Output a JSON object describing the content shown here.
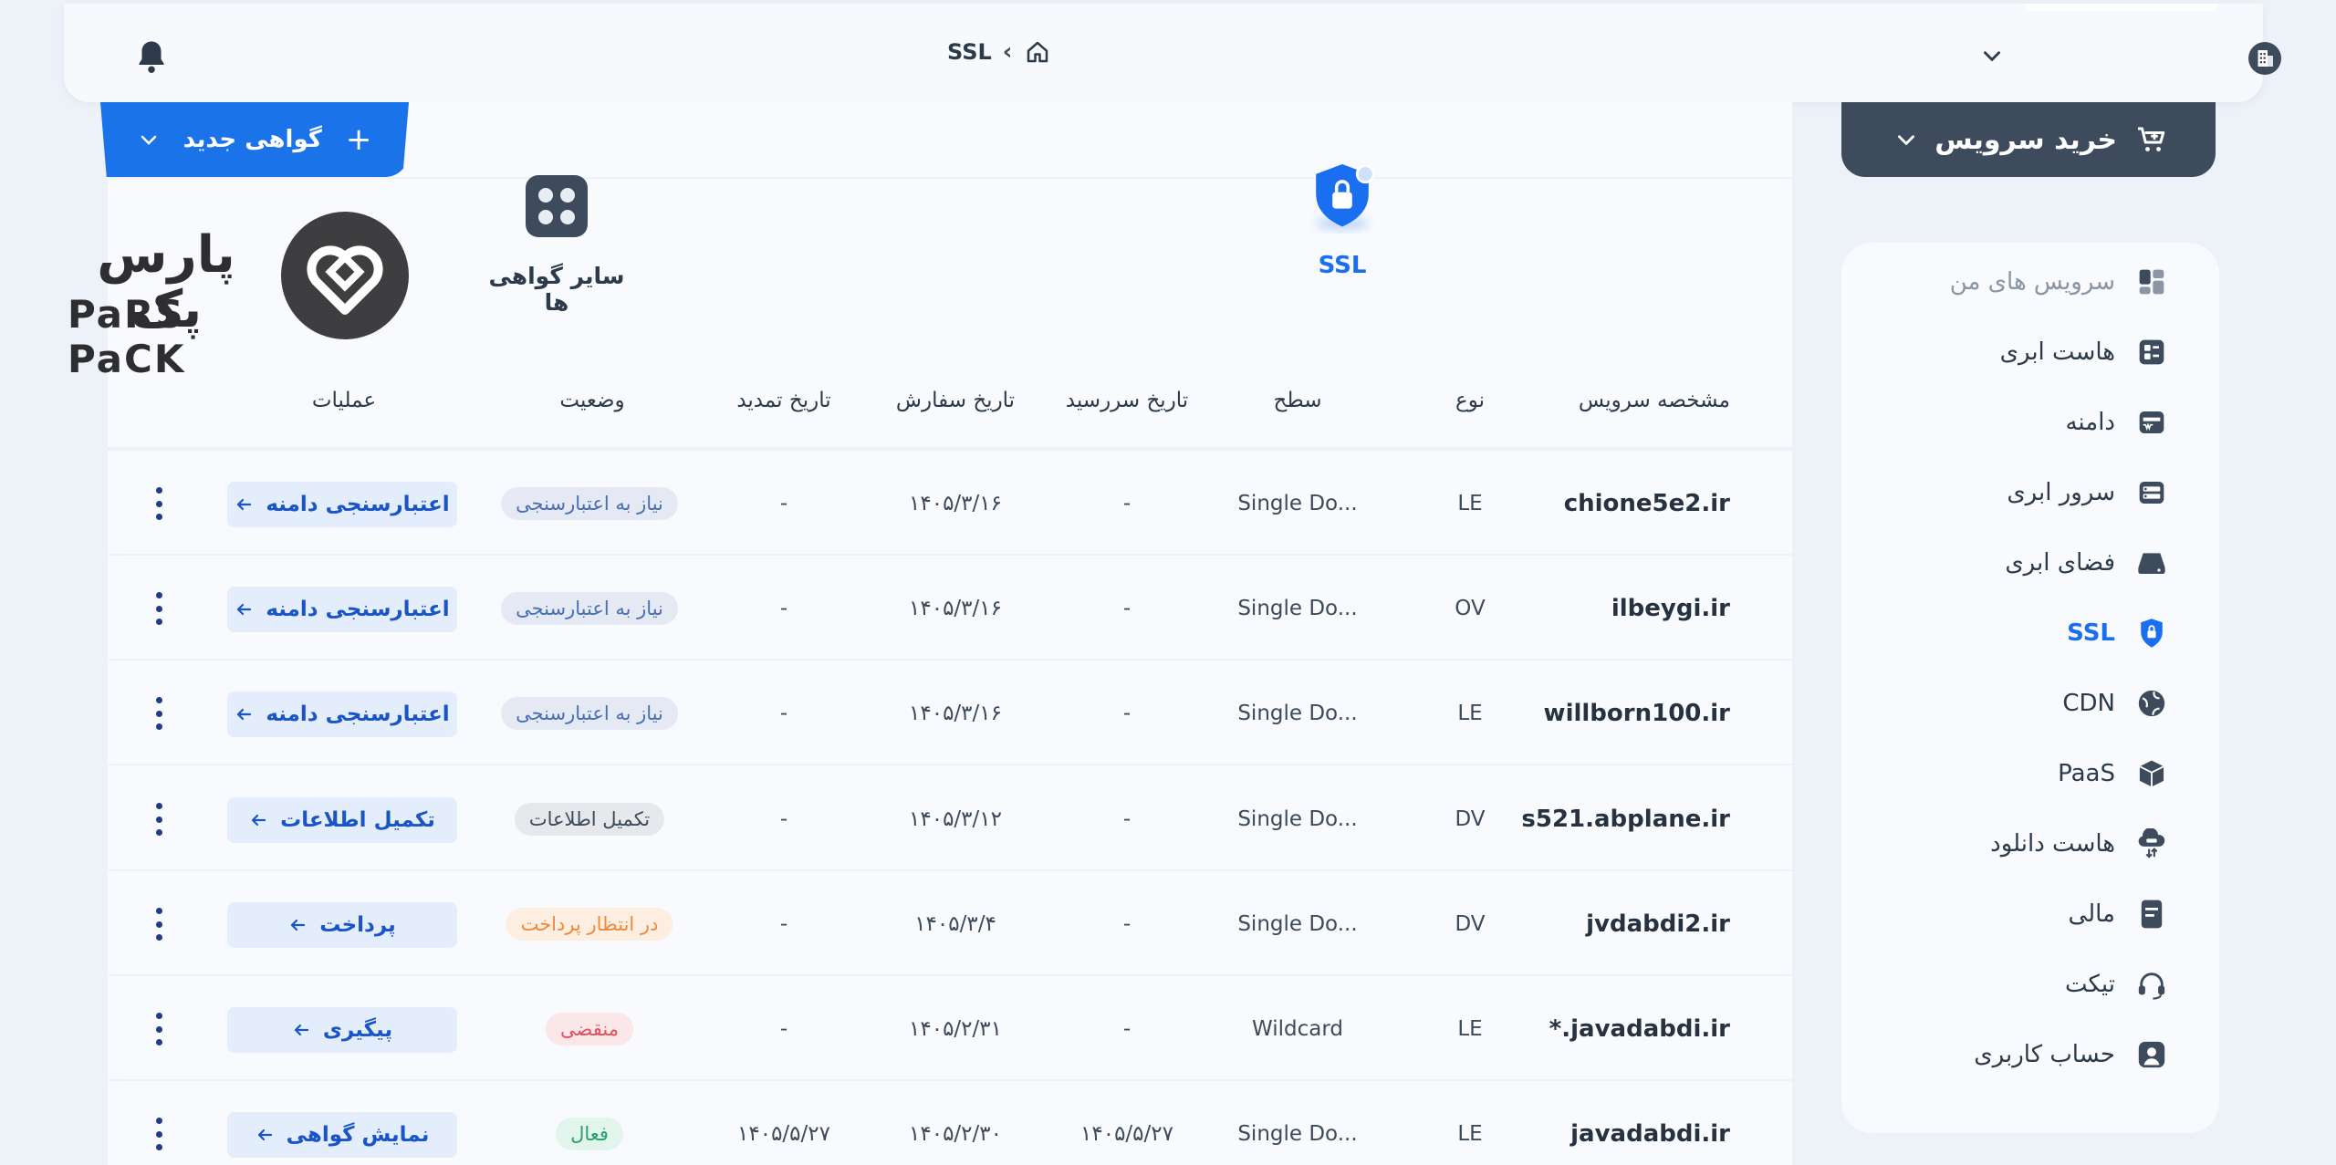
{
  "topbar": {
    "breadcrumb_current": "SSL",
    "breadcrumb_sep": "‹"
  },
  "sidebar": {
    "buy_label": "خرید سرویس",
    "items": [
      {
        "label": "سرویس های من",
        "icon": "dashboard-icon",
        "state": "muted"
      },
      {
        "label": "هاست ابری",
        "icon": "cloud-host-icon",
        "state": "normal"
      },
      {
        "label": "دامنه",
        "icon": "domain-icon",
        "state": "normal"
      },
      {
        "label": "سرور ابری",
        "icon": "cloud-server-icon",
        "state": "normal"
      },
      {
        "label": "فضای ابری",
        "icon": "cloud-storage-icon",
        "state": "normal"
      },
      {
        "label": "SSL",
        "icon": "ssl-shield-icon",
        "state": "active"
      },
      {
        "label": "CDN",
        "icon": "cdn-globe-icon",
        "state": "normal"
      },
      {
        "label": "PaaS",
        "icon": "paas-cube-icon",
        "state": "normal"
      },
      {
        "label": "هاست دانلود",
        "icon": "download-host-icon",
        "state": "normal"
      },
      {
        "label": "مالی",
        "icon": "finance-icon",
        "state": "normal"
      },
      {
        "label": "تیکت",
        "icon": "headset-icon",
        "state": "normal"
      },
      {
        "label": "حساب کاربری",
        "icon": "user-account-icon",
        "state": "normal"
      }
    ]
  },
  "main": {
    "new_cert_label": "گواهی جدید",
    "tabs": [
      {
        "label": "SSL",
        "active": true
      },
      {
        "label": "سایر گواهی ها",
        "active": false
      }
    ],
    "logo": {
      "word_fa": "پارس پک",
      "word_en": "PaRS PaCK"
    }
  },
  "table": {
    "headers": {
      "name": "مشخصه سرویس",
      "type": "نوع",
      "level": "سطح",
      "due": "تاریخ سررسید",
      "order": "تاریخ سفارش",
      "renew": "تاریخ تمدید",
      "status": "وضعیت",
      "ops": "عملیات"
    },
    "rows": [
      {
        "name": "chione5e2.ir",
        "type": "LE",
        "level": "Single Do...",
        "due": "-",
        "order": "۱۴۰۵/۳/۱۶",
        "renew": "-",
        "status": "نیاز به اعتبارسنجی",
        "status_kind": "need",
        "action": "اعتبارسنجی دامنه"
      },
      {
        "name": "ilbeygi.ir",
        "type": "OV",
        "level": "Single Do...",
        "due": "-",
        "order": "۱۴۰۵/۳/۱۶",
        "renew": "-",
        "status": "نیاز به اعتبارسنجی",
        "status_kind": "need",
        "action": "اعتبارسنجی دامنه"
      },
      {
        "name": "willborn100.ir",
        "type": "LE",
        "level": "Single Do...",
        "due": "-",
        "order": "۱۴۰۵/۳/۱۶",
        "renew": "-",
        "status": "نیاز به اعتبارسنجی",
        "status_kind": "need",
        "action": "اعتبارسنجی دامنه"
      },
      {
        "name": "s521.abplane.ir",
        "type": "DV",
        "level": "Single Do...",
        "due": "-",
        "order": "۱۴۰۵/۳/۱۲",
        "renew": "-",
        "status": "تکمیل اطلاعات",
        "status_kind": "info",
        "action": "تکمیل اطلاعات"
      },
      {
        "name": "jvdabdi2.ir",
        "type": "DV",
        "level": "Single Do...",
        "due": "-",
        "order": "۱۴۰۵/۳/۴",
        "renew": "-",
        "status": "در انتظار پرداخت",
        "status_kind": "pay",
        "action": "پرداخت"
      },
      {
        "name": "*.javadabdi.ir",
        "type": "LE",
        "level": "Wildcard",
        "due": "-",
        "order": "۱۴۰۵/۲/۳۱",
        "renew": "-",
        "status": "منقضی",
        "status_kind": "expired",
        "action": "پیگیری"
      },
      {
        "name": "javadabdi.ir",
        "type": "LE",
        "level": "Single Do...",
        "due": "۱۴۰۵/۵/۲۷",
        "order": "۱۴۰۵/۲/۳۰",
        "renew": "۱۴۰۵/۵/۲۷",
        "status": "فعال",
        "status_kind": "active",
        "action": "نمایش گواهی"
      }
    ]
  },
  "colors": {
    "accent": "#1a73e8",
    "dark": "#3d4b5c",
    "need_bg": "#e4e9f4",
    "need_fg": "#4a6fb0",
    "info_bg": "#e6e8ec",
    "info_fg": "#3c4a5a",
    "pay_bg": "#fdeee2",
    "pay_fg": "#f08a3a",
    "expired_bg": "#fbe6e8",
    "expired_fg": "#e0505e",
    "active_bg": "#e2f5ec",
    "active_fg": "#28a06a"
  }
}
